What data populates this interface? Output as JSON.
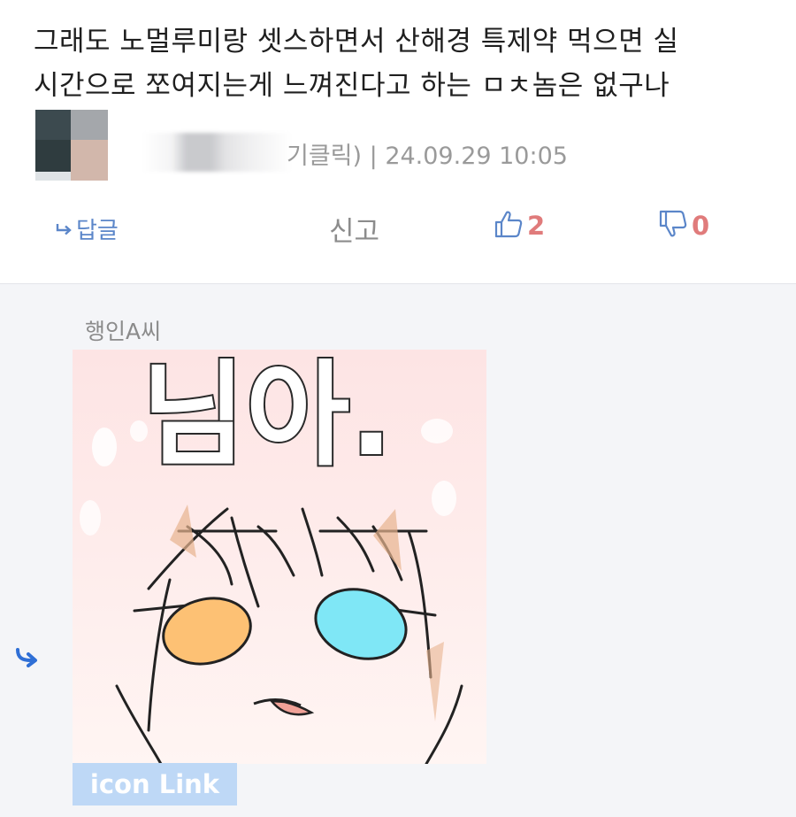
{
  "comment": {
    "text_lines": [
      "그래도 노멀루미랑 셋스하면서 산해경 특제약 먹으면 실",
      "시간으로 쪼여지는게 느껴진다고 하는 ㅁㅊ놈은 없구나"
    ],
    "meta": "기클릭) | 24.09.29 10:05",
    "actions": {
      "reply_label": "답글",
      "report_label": "신고",
      "like_count": "2",
      "dislike_count": "0"
    },
    "icons": {
      "reply": "reply-arrow-icon",
      "like": "thumbs-up-icon",
      "dislike": "thumbs-down-icon"
    }
  },
  "reply": {
    "author": "행인A씨",
    "sticker_text": "님아.",
    "link_label": "icon Link",
    "icons": {
      "reply": "reply-arrow-icon"
    }
  },
  "colors": {
    "accent_blue": "#5b86c9",
    "count_red": "#e07b7b",
    "reply_bg": "#f4f5f8",
    "link_bg": "#bed8f6"
  }
}
